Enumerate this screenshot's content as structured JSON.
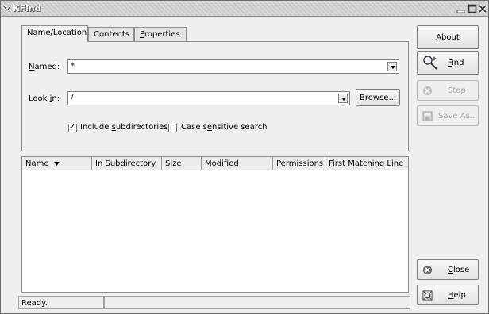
{
  "window": {
    "title": "KFind"
  },
  "tabs": [
    {
      "label_pre": "Name/",
      "label_ul": "L",
      "label_post": "ocation"
    },
    {
      "label": "Contents"
    },
    {
      "label_ul": "P",
      "label_post": "roperties"
    }
  ],
  "named": {
    "label_ul": "N",
    "label_post": "amed:",
    "value": "*"
  },
  "lookin": {
    "label_pre": "Look ",
    "label_ul": "i",
    "label_post": "n:",
    "value": "/",
    "browse_ul": "B",
    "browse_post": "rowse..."
  },
  "options": {
    "include_pre": "Include ",
    "include_ul": "s",
    "include_post": "ubdirectories",
    "case_pre": "Case s",
    "case_ul": "e",
    "case_post": "nsitive search"
  },
  "columns": [
    "Name",
    "In Subdirectory",
    "Size",
    "Modified",
    "Permissions",
    "First Matching Line"
  ],
  "status": {
    "text": "Ready."
  },
  "sidebar": {
    "about": "About",
    "find_ul": "F",
    "find_post": "ind",
    "stop": "Stop",
    "saveas": "Save As...",
    "close_ul": "C",
    "close_post": "lose",
    "help_ul": "H",
    "help_post": "elp"
  }
}
